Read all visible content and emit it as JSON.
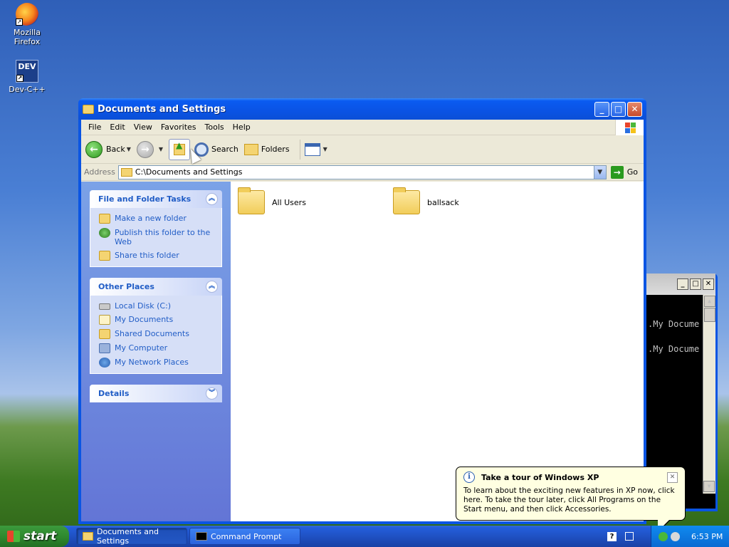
{
  "desktop": {
    "icons": [
      {
        "label": "Mozilla Firefox",
        "icon": "firefox-icon"
      },
      {
        "label": "Dev-C++",
        "icon": "devcpp-icon",
        "badge": "DEV"
      }
    ]
  },
  "explorer": {
    "title": "Documents and Settings",
    "menu": [
      "File",
      "Edit",
      "View",
      "Favorites",
      "Tools",
      "Help"
    ],
    "toolbar": {
      "back_label": "Back",
      "search_label": "Search",
      "folders_label": "Folders"
    },
    "address": {
      "label": "Address",
      "value": "C:\\Documents and Settings",
      "go_label": "Go"
    },
    "panels": {
      "file_tasks": {
        "title": "File and Folder Tasks",
        "items": [
          "Make a new folder",
          "Publish this folder to the Web",
          "Share this folder"
        ]
      },
      "other_places": {
        "title": "Other Places",
        "items": [
          "Local Disk (C:)",
          "My Documents",
          "Shared Documents",
          "My Computer",
          "My Network Places"
        ]
      },
      "details": {
        "title": "Details"
      }
    },
    "files": [
      {
        "name": "All Users"
      },
      {
        "name": "ballsack"
      }
    ]
  },
  "cmd": {
    "lines": [
      ".My Docume",
      ".My Docume"
    ]
  },
  "balloon": {
    "title": "Take a tour of Windows XP",
    "text": "To learn about the exciting new features in XP now, click here. To take the tour later, click All Programs on the Start menu, and then click Accessories."
  },
  "taskbar": {
    "start_label": "start",
    "buttons": [
      "Documents and Settings",
      "Command Prompt"
    ],
    "clock": "6:53 PM"
  },
  "colors": {
    "title_blue": "#0a55e3",
    "task_link": "#215dc6",
    "balloon_bg": "#ffffe1",
    "start_green": "#2f8a2f"
  }
}
